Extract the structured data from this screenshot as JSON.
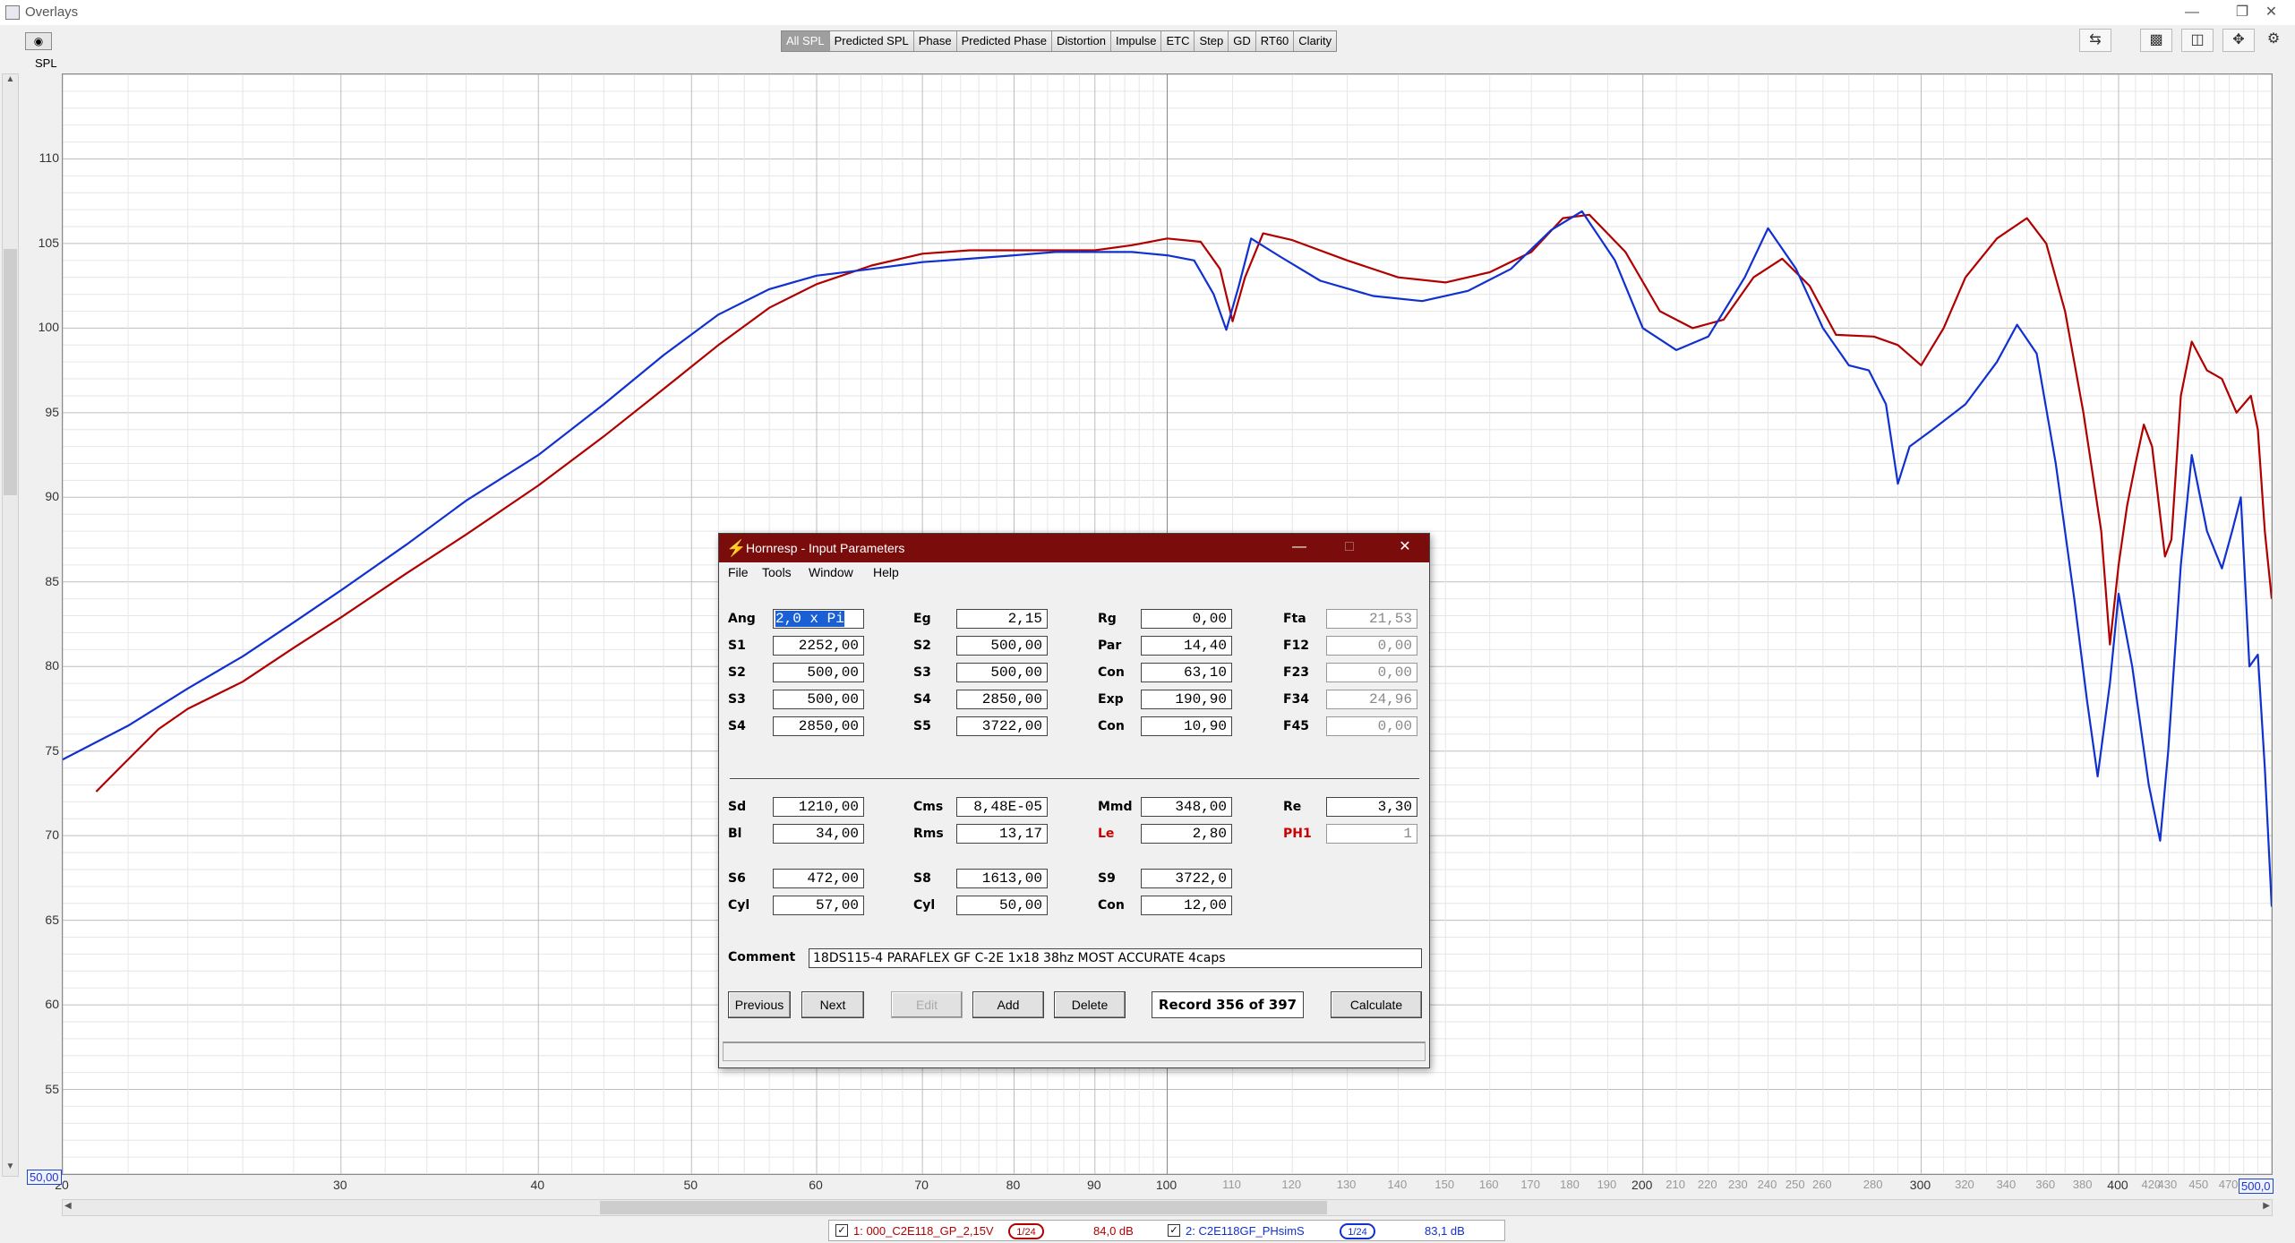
{
  "window": {
    "title": "Overlays"
  },
  "toolbar": {
    "tabs": [
      "All SPL",
      "Predicted SPL",
      "Phase",
      "Predicted Phase",
      "Distortion",
      "Impulse",
      "ETC",
      "Step",
      "GD",
      "RT60",
      "Clarity"
    ],
    "active": "All SPL"
  },
  "plot": {
    "y_axis_label": "SPL",
    "y_min_box": "50,00",
    "x_max_box": "500,0"
  },
  "legend": {
    "trace1": {
      "name": "1: 000_C2E118_GP_2,15V",
      "smoothing": "1/24",
      "value": "84,0 dB",
      "color": "#b00000"
    },
    "trace2": {
      "name": "2: C2E118GF_PHsimS",
      "smoothing": "1/24",
      "value": "83,1 dB",
      "color": "#1030d0"
    }
  },
  "chart_data": {
    "type": "line",
    "xlabel": "",
    "ylabel": "SPL",
    "xscale": "log",
    "xlim": [
      20,
      500
    ],
    "ylim": [
      50,
      115
    ],
    "yticks": [
      55,
      60,
      65,
      70,
      75,
      80,
      85,
      90,
      95,
      100,
      105,
      110
    ],
    "xticks_major": [
      20,
      30,
      40,
      50,
      60,
      70,
      80,
      90,
      100,
      200,
      300,
      400
    ],
    "xticks_minor": [
      110,
      120,
      130,
      140,
      150,
      160,
      170,
      180,
      190,
      210,
      220,
      230,
      240,
      250,
      260,
      280,
      320,
      340,
      360,
      380,
      420,
      430,
      450,
      470
    ],
    "grid": true,
    "series": [
      {
        "name": "1: 000_C2E118_GP_2,15V",
        "color": "#b00000",
        "points": [
          [
            21,
            72.6
          ],
          [
            22,
            74.5
          ],
          [
            23,
            76.3
          ],
          [
            24,
            77.5
          ],
          [
            26,
            79.1
          ],
          [
            28,
            81.1
          ],
          [
            30,
            82.9
          ],
          [
            33,
            85.5
          ],
          [
            36,
            87.8
          ],
          [
            40,
            90.7
          ],
          [
            44,
            93.6
          ],
          [
            48,
            96.4
          ],
          [
            52,
            99.0
          ],
          [
            56,
            101.2
          ],
          [
            60,
            102.6
          ],
          [
            65,
            103.7
          ],
          [
            70,
            104.4
          ],
          [
            75,
            104.6
          ],
          [
            80,
            104.6
          ],
          [
            85,
            104.6
          ],
          [
            90,
            104.6
          ],
          [
            95,
            104.9
          ],
          [
            100,
            105.3
          ],
          [
            105,
            105.1
          ],
          [
            108,
            103.5
          ],
          [
            110,
            100.4
          ],
          [
            112,
            103.0
          ],
          [
            115,
            105.6
          ],
          [
            120,
            105.2
          ],
          [
            130,
            104.0
          ],
          [
            140,
            103.0
          ],
          [
            150,
            102.7
          ],
          [
            160,
            103.3
          ],
          [
            170,
            104.5
          ],
          [
            178,
            106.5
          ],
          [
            185,
            106.7
          ],
          [
            195,
            104.5
          ],
          [
            205,
            101.0
          ],
          [
            215,
            100.0
          ],
          [
            225,
            100.5
          ],
          [
            235,
            103.0
          ],
          [
            245,
            104.1
          ],
          [
            255,
            102.5
          ],
          [
            265,
            99.6
          ],
          [
            280,
            99.5
          ],
          [
            290,
            99.0
          ],
          [
            300,
            97.8
          ],
          [
            310,
            100.0
          ],
          [
            320,
            103.0
          ],
          [
            335,
            105.3
          ],
          [
            350,
            106.5
          ],
          [
            360,
            105.0
          ],
          [
            370,
            101.0
          ],
          [
            380,
            95.0
          ],
          [
            390,
            88.0
          ],
          [
            395,
            81.3
          ],
          [
            400,
            86.0
          ],
          [
            405,
            89.5
          ],
          [
            410,
            92.0
          ],
          [
            415,
            94.3
          ],
          [
            420,
            93.0
          ],
          [
            428,
            86.5
          ],
          [
            432,
            87.5
          ],
          [
            438,
            96.0
          ],
          [
            445,
            99.2
          ],
          [
            455,
            97.5
          ],
          [
            465,
            97.0
          ],
          [
            475,
            95.0
          ],
          [
            485,
            96.0
          ],
          [
            490,
            94.0
          ],
          [
            495,
            88.0
          ],
          [
            500,
            84.0
          ]
        ]
      },
      {
        "name": "2: C2E118GF_PHsimS",
        "color": "#1030d0",
        "points": [
          [
            20,
            74.5
          ],
          [
            22,
            76.5
          ],
          [
            24,
            78.7
          ],
          [
            26,
            80.6
          ],
          [
            28,
            82.6
          ],
          [
            30,
            84.5
          ],
          [
            33,
            87.2
          ],
          [
            36,
            89.8
          ],
          [
            40,
            92.5
          ],
          [
            44,
            95.5
          ],
          [
            48,
            98.4
          ],
          [
            52,
            100.8
          ],
          [
            56,
            102.3
          ],
          [
            60,
            103.1
          ],
          [
            65,
            103.5
          ],
          [
            70,
            103.9
          ],
          [
            75,
            104.1
          ],
          [
            80,
            104.3
          ],
          [
            85,
            104.5
          ],
          [
            90,
            104.5
          ],
          [
            95,
            104.5
          ],
          [
            100,
            104.3
          ],
          [
            104,
            104.0
          ],
          [
            107,
            102.0
          ],
          [
            109,
            99.9
          ],
          [
            111,
            102.5
          ],
          [
            113,
            105.3
          ],
          [
            118,
            104.2
          ],
          [
            125,
            102.8
          ],
          [
            135,
            101.9
          ],
          [
            145,
            101.6
          ],
          [
            155,
            102.2
          ],
          [
            165,
            103.5
          ],
          [
            175,
            105.8
          ],
          [
            183,
            106.9
          ],
          [
            192,
            104.0
          ],
          [
            200,
            100.0
          ],
          [
            210,
            98.7
          ],
          [
            220,
            99.5
          ],
          [
            232,
            103.0
          ],
          [
            240,
            105.9
          ],
          [
            250,
            103.5
          ],
          [
            260,
            100.0
          ],
          [
            270,
            97.8
          ],
          [
            278,
            97.5
          ],
          [
            285,
            95.5
          ],
          [
            290,
            90.8
          ],
          [
            295,
            93.0
          ],
          [
            305,
            94.0
          ],
          [
            320,
            95.5
          ],
          [
            335,
            98.0
          ],
          [
            345,
            100.2
          ],
          [
            355,
            98.5
          ],
          [
            365,
            92.0
          ],
          [
            375,
            84.0
          ],
          [
            382,
            78.0
          ],
          [
            388,
            73.5
          ],
          [
            395,
            79.0
          ],
          [
            400,
            84.3
          ],
          [
            408,
            80.0
          ],
          [
            418,
            73.0
          ],
          [
            425,
            69.7
          ],
          [
            430,
            75.0
          ],
          [
            438,
            86.0
          ],
          [
            445,
            92.5
          ],
          [
            455,
            88.0
          ],
          [
            465,
            85.8
          ],
          [
            472,
            88.0
          ],
          [
            478,
            90.0
          ],
          [
            484,
            80.0
          ],
          [
            490,
            80.7
          ],
          [
            495,
            74.0
          ],
          [
            500,
            65.8
          ]
        ]
      }
    ]
  },
  "dialog": {
    "title": "Hornresp - Input Parameters",
    "menu": [
      "File",
      "Tools",
      "Window",
      "Help"
    ],
    "labels": {
      "ang": "Ang",
      "eg": "Eg",
      "rg": "Rg",
      "fta": "Fta",
      "s1a": "S1",
      "s2a": "S2",
      "par": "Par",
      "f12": "F12",
      "s2b": "S2",
      "s3a": "S3",
      "con1": "Con",
      "f23": "F23",
      "s3b": "S3",
      "s4a": "S4",
      "exp": "Exp",
      "f34": "F34",
      "s4b": "S4",
      "s5": "S5",
      "con2": "Con",
      "f45": "F45",
      "sd": "Sd",
      "cms": "Cms",
      "mmd": "Mmd",
      "re": "Re",
      "bl": "Bl",
      "rms": "Rms",
      "le": "Le",
      "ph1": "PH1",
      "s6": "S6",
      "s8": "S8",
      "s9": "S9",
      "cyl1": "Cyl",
      "cyl2": "Cyl",
      "con3": "Con",
      "comment": "Comment"
    },
    "values": {
      "ang": "2,0 x Pi",
      "eg": "2,15",
      "rg": "0,00",
      "fta": "21,53",
      "s1a": "2252,00",
      "s2a": "500,00",
      "par": "14,40",
      "f12": "0,00",
      "s2b": "500,00",
      "s3a": "500,00",
      "con1": "63,10",
      "f23": "0,00",
      "s3b": "500,00",
      "s4a": "2850,00",
      "exp": "190,90",
      "f34": "24,96",
      "s4b": "2850,00",
      "s5": "3722,00",
      "con2": "10,90",
      "f45": "0,00",
      "sd": "1210,00",
      "cms": "8,48E-05",
      "mmd": "348,00",
      "re": "3,30",
      "bl": "34,00",
      "rms": "13,17",
      "le": "2,80",
      "ph1": "1",
      "s6": "472,00",
      "s8": "1613,00",
      "s9": "3722,0",
      "cyl1": "57,00",
      "cyl2": "50,00",
      "con3": "12,00"
    },
    "comment": "18DS115-4 PARAFLEX GF C-2E 1x18 38hz MOST ACCURATE  4caps",
    "buttons": {
      "previous": "Previous",
      "next": "Next",
      "edit": "Edit",
      "add": "Add",
      "delete": "Delete",
      "calculate": "Calculate"
    },
    "record": "Record 356 of 397"
  }
}
